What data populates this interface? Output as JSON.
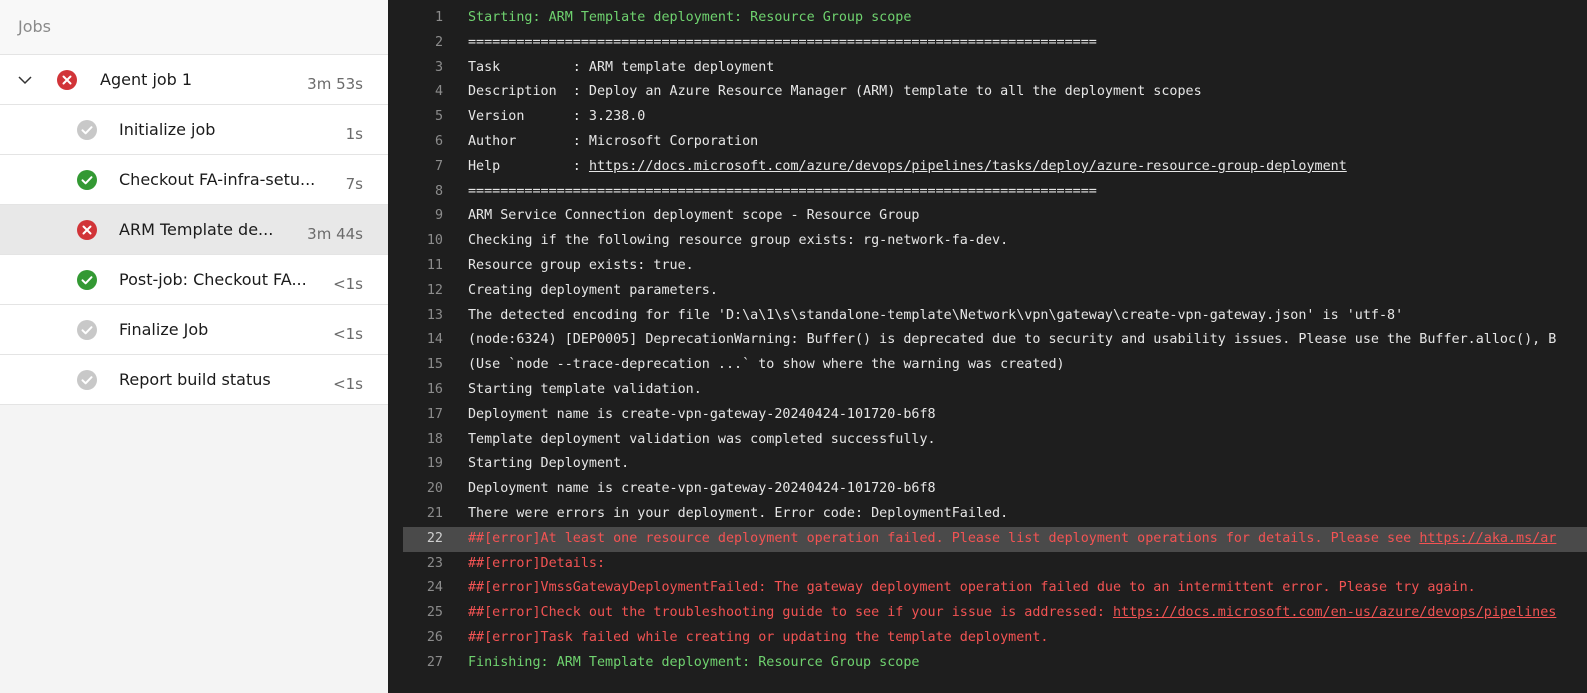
{
  "jobs_panel": {
    "header": "Jobs",
    "parent_job": {
      "label": "Agent job 1",
      "duration": "3m 53s",
      "status": "failed",
      "expanded": true
    },
    "steps": [
      {
        "label": "Initialize job",
        "duration": "1s",
        "status": "skipped",
        "selected": false
      },
      {
        "label": "Checkout FA-infra-setu...",
        "duration": "7s",
        "status": "succeeded",
        "selected": false
      },
      {
        "label": "ARM Template de...",
        "duration": "3m 44s",
        "status": "failed",
        "selected": true
      },
      {
        "label": "Post-job: Checkout FA...",
        "duration": "<1s",
        "status": "succeeded",
        "selected": false
      },
      {
        "label": "Finalize Job",
        "duration": "<1s",
        "status": "skipped",
        "selected": false
      },
      {
        "label": "Report build status",
        "duration": "<1s",
        "status": "skipped",
        "selected": false
      }
    ],
    "status_colors": {
      "failed": "#d13438",
      "succeeded": "#339933",
      "skipped": "#c8c8c8"
    }
  },
  "log": {
    "highlighted_line": 22,
    "lines": [
      {
        "n": "1",
        "kind": "green",
        "segments": [
          {
            "t": "Starting: ARM Template deployment: Resource Group scope"
          }
        ]
      },
      {
        "n": "2",
        "kind": "normal",
        "segments": [
          {
            "t": "=============================================================================="
          }
        ]
      },
      {
        "n": "3",
        "kind": "normal",
        "segments": [
          {
            "t": "Task         : ARM template deployment"
          }
        ]
      },
      {
        "n": "4",
        "kind": "normal",
        "segments": [
          {
            "t": "Description  : Deploy an Azure Resource Manager (ARM) template to all the deployment scopes"
          }
        ]
      },
      {
        "n": "5",
        "kind": "normal",
        "segments": [
          {
            "t": "Version      : 3.238.0"
          }
        ]
      },
      {
        "n": "6",
        "kind": "normal",
        "segments": [
          {
            "t": "Author       : Microsoft Corporation"
          }
        ]
      },
      {
        "n": "7",
        "kind": "normal",
        "segments": [
          {
            "t": "Help         : "
          },
          {
            "t": "https://docs.microsoft.com/azure/devops/pipelines/tasks/deploy/azure-resource-group-deployment",
            "link": true
          }
        ]
      },
      {
        "n": "8",
        "kind": "normal",
        "segments": [
          {
            "t": "=============================================================================="
          }
        ]
      },
      {
        "n": "9",
        "kind": "normal",
        "segments": [
          {
            "t": "ARM Service Connection deployment scope - Resource Group"
          }
        ]
      },
      {
        "n": "10",
        "kind": "normal",
        "segments": [
          {
            "t": "Checking if the following resource group exists: rg-network-fa-dev."
          }
        ]
      },
      {
        "n": "11",
        "kind": "normal",
        "segments": [
          {
            "t": "Resource group exists: true."
          }
        ]
      },
      {
        "n": "12",
        "kind": "normal",
        "segments": [
          {
            "t": "Creating deployment parameters."
          }
        ]
      },
      {
        "n": "13",
        "kind": "normal",
        "segments": [
          {
            "t": "The detected encoding for file 'D:\\a\\1\\s\\standalone-template\\Network\\vpn\\gateway\\create-vpn-gateway.json' is 'utf-8'"
          }
        ]
      },
      {
        "n": "14",
        "kind": "normal",
        "segments": [
          {
            "t": "(node:6324) [DEP0005] DeprecationWarning: Buffer() is deprecated due to security and usability issues. Please use the Buffer.alloc(), B"
          }
        ]
      },
      {
        "n": "15",
        "kind": "normal",
        "segments": [
          {
            "t": "(Use `node --trace-deprecation ...` to show where the warning was created)"
          }
        ]
      },
      {
        "n": "16",
        "kind": "normal",
        "segments": [
          {
            "t": "Starting template validation."
          }
        ]
      },
      {
        "n": "17",
        "kind": "normal",
        "segments": [
          {
            "t": "Deployment name is create-vpn-gateway-20240424-101720-b6f8"
          }
        ]
      },
      {
        "n": "18",
        "kind": "normal",
        "segments": [
          {
            "t": "Template deployment validation was completed successfully."
          }
        ]
      },
      {
        "n": "19",
        "kind": "normal",
        "segments": [
          {
            "t": "Starting Deployment."
          }
        ]
      },
      {
        "n": "20",
        "kind": "normal",
        "segments": [
          {
            "t": "Deployment name is create-vpn-gateway-20240424-101720-b6f8"
          }
        ]
      },
      {
        "n": "21",
        "kind": "normal",
        "segments": [
          {
            "t": "There were errors in your deployment. Error code: DeploymentFailed."
          }
        ]
      },
      {
        "n": "22",
        "kind": "error",
        "segments": [
          {
            "t": "##[error]At least one resource deployment operation failed. Please list deployment operations for details. Please see "
          },
          {
            "t": "https://aka.ms/ar",
            "link": true
          }
        ]
      },
      {
        "n": "23",
        "kind": "error",
        "segments": [
          {
            "t": "##[error]Details:"
          }
        ]
      },
      {
        "n": "24",
        "kind": "error",
        "segments": [
          {
            "t": "##[error]VmssGatewayDeploymentFailed: The gateway deployment operation failed due to an intermittent error. Please try again."
          }
        ]
      },
      {
        "n": "25",
        "kind": "error",
        "segments": [
          {
            "t": "##[error]Check out the troubleshooting guide to see if your issue is addressed: "
          },
          {
            "t": "https://docs.microsoft.com/en-us/azure/devops/pipelines",
            "link": true
          }
        ]
      },
      {
        "n": "26",
        "kind": "error",
        "segments": [
          {
            "t": "##[error]Task failed while creating or updating the template deployment."
          }
        ]
      },
      {
        "n": "27",
        "kind": "green",
        "segments": [
          {
            "t": "Finishing: ARM Template deployment: Resource Group scope"
          }
        ]
      }
    ]
  }
}
